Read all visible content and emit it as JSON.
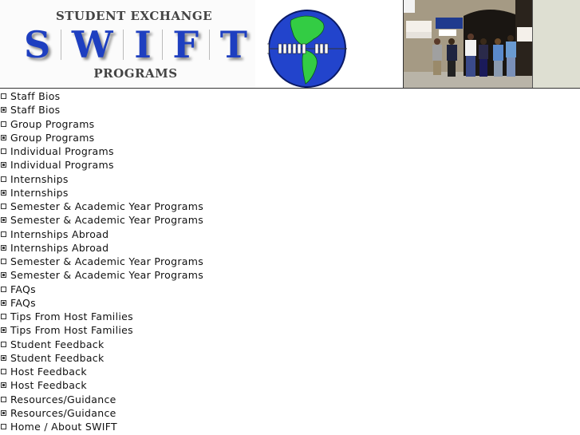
{
  "header": {
    "logo": {
      "top_text": "STUDENT EXCHANGE",
      "letters": [
        "S",
        "W",
        "I",
        "F",
        "T"
      ],
      "bottom_text": "PROGRAMS"
    },
    "globe_icon": "globe-with-students-icon",
    "photo": {
      "description": "students-in-front-of-travel-programs-office",
      "signs": [
        "TRAVEL PROGRAMS",
        "host an exch student"
      ]
    },
    "colors": {
      "swift_blue": "#1e3fc0",
      "globe_blue": "#2244cc",
      "land_green": "#33cc44",
      "side_panel": "#dedfd2"
    }
  },
  "nav": {
    "items": [
      {
        "label": "Staff Bios",
        "bullet": "empty"
      },
      {
        "label": "Staff Bios",
        "bullet": "filled"
      },
      {
        "label": "Group Programs",
        "bullet": "empty"
      },
      {
        "label": "Group Programs",
        "bullet": "filled"
      },
      {
        "label": "Individual Programs",
        "bullet": "empty"
      },
      {
        "label": "Individual Programs",
        "bullet": "filled"
      },
      {
        "label": "Internships",
        "bullet": "empty"
      },
      {
        "label": "Internships",
        "bullet": "filled"
      },
      {
        "label": "Semester & Academic Year Programs",
        "bullet": "empty"
      },
      {
        "label": "Semester & Academic Year Programs",
        "bullet": "filled"
      },
      {
        "label": "Internships Abroad",
        "bullet": "empty"
      },
      {
        "label": "Internships Abroad",
        "bullet": "filled"
      },
      {
        "label": "Semester & Academic Year Programs",
        "bullet": "empty"
      },
      {
        "label": "Semester & Academic Year Programs",
        "bullet": "filled"
      },
      {
        "label": "FAQs",
        "bullet": "empty"
      },
      {
        "label": "FAQs",
        "bullet": "filled"
      },
      {
        "label": "Tips From Host Families",
        "bullet": "empty"
      },
      {
        "label": "Tips From Host Families",
        "bullet": "filled"
      },
      {
        "label": "Student Feedback",
        "bullet": "empty"
      },
      {
        "label": "Student Feedback",
        "bullet": "filled"
      },
      {
        "label": "Host Feedback",
        "bullet": "empty"
      },
      {
        "label": "Host Feedback",
        "bullet": "filled"
      },
      {
        "label": "Resources/Guidance",
        "bullet": "empty"
      },
      {
        "label": "Resources/Guidance",
        "bullet": "filled"
      },
      {
        "label": "Home / About SWIFT",
        "bullet": "empty"
      }
    ]
  }
}
